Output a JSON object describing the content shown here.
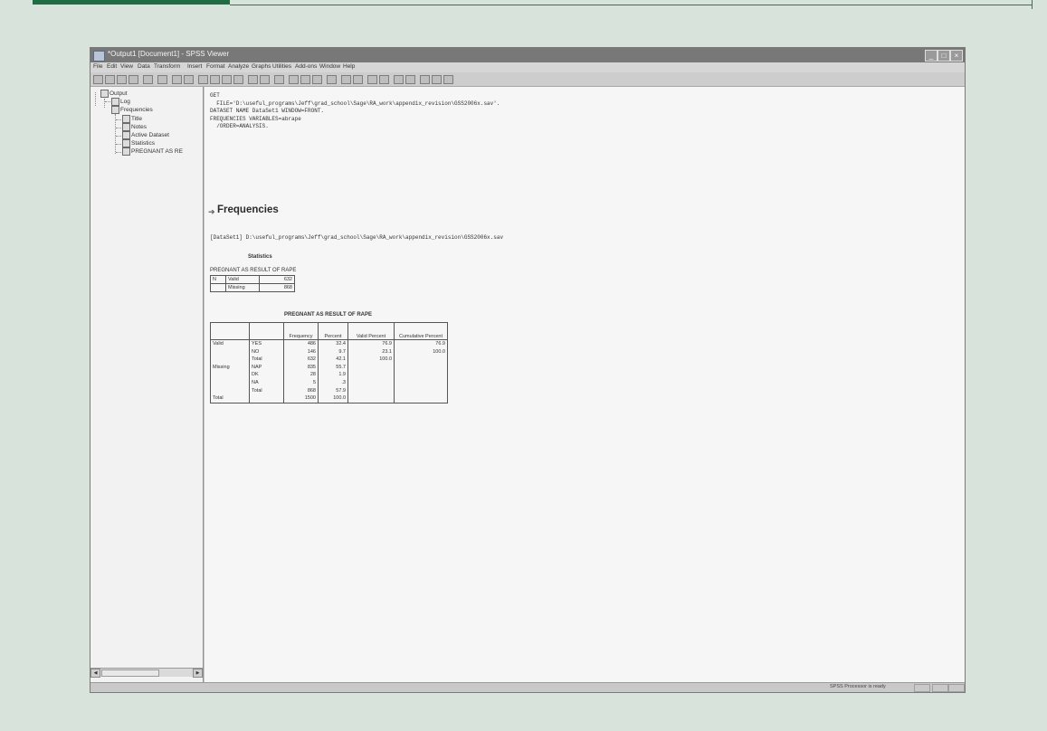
{
  "window": {
    "title": "*Output1 [Document1] - SPSS Viewer"
  },
  "window_buttons": [
    "_",
    "□",
    "×"
  ],
  "menu": [
    "File",
    "Edit",
    "View",
    "Data",
    "Transform",
    "Insert",
    "Format",
    "Analyze",
    "Graphs",
    "Utilities",
    "Add-ons",
    "Window",
    "Help"
  ],
  "outline": {
    "root": "Output",
    "items": [
      {
        "label": "Log",
        "icon": "log-icon"
      },
      {
        "label": "Frequencies",
        "icon": "book-icon"
      },
      {
        "label": "Title",
        "icon": "title-icon"
      },
      {
        "label": "Notes",
        "icon": "notes-icon"
      },
      {
        "label": "Active Dataset",
        "icon": "dataset-icon"
      },
      {
        "label": "Statistics",
        "icon": "table-icon"
      },
      {
        "label": "PREGNANT AS RE",
        "icon": "table-icon"
      }
    ]
  },
  "syntax_lines": [
    "GET",
    "  FILE='D:\\useful_programs\\Jeff\\grad_school\\Sage\\RA_work\\appendix_revision\\GSS2006x.sav'.",
    "DATASET NAME DataSet1 WINDOW=FRONT.",
    "FREQUENCIES VARIABLES=abrape",
    "  /ORDER=ANALYSIS."
  ],
  "heading": "Frequencies",
  "dataset_line": "[DataSet1] D:\\useful_programs\\Jeff\\grad_school\\Sage\\RA_work\\appendix_revision\\GSS2006x.sav",
  "statistics": {
    "title": "Statistics",
    "subtitle": "PREGNANT AS RESULT OF RAPE",
    "rows": [
      {
        "c1": "N",
        "c2": "Valid",
        "value": "632"
      },
      {
        "c1": "",
        "c2": "Missing",
        "value": "868"
      }
    ]
  },
  "frequency_table": {
    "title": "PREGNANT AS RESULT OF RAPE",
    "headers": [
      "",
      "",
      "Frequency",
      "Percent",
      "Valid Percent",
      "Cumulative Percent"
    ],
    "rows": [
      {
        "group": "Valid",
        "label": "YES",
        "freq": "486",
        "pct": "32.4",
        "valid": "76.9",
        "cum": "76.9"
      },
      {
        "group": "",
        "label": "NO",
        "freq": "146",
        "pct": "9.7",
        "valid": "23.1",
        "cum": "100.0"
      },
      {
        "group": "",
        "label": "Total",
        "freq": "632",
        "pct": "42.1",
        "valid": "100.0",
        "cum": ""
      },
      {
        "group": "Missing",
        "label": "NAP",
        "freq": "835",
        "pct": "55.7",
        "valid": "",
        "cum": ""
      },
      {
        "group": "",
        "label": "DK",
        "freq": "28",
        "pct": "1.9",
        "valid": "",
        "cum": ""
      },
      {
        "group": "",
        "label": "NA",
        "freq": "5",
        "pct": ".3",
        "valid": "",
        "cum": ""
      },
      {
        "group": "",
        "label": "Total",
        "freq": "868",
        "pct": "57.9",
        "valid": "",
        "cum": ""
      },
      {
        "group": "Total",
        "label": "",
        "freq": "1500",
        "pct": "100.0",
        "valid": "",
        "cum": ""
      }
    ]
  },
  "status": "SPSS  Processor is ready",
  "colors": {
    "background": "#d8e3dc",
    "accent": "#1f6e43",
    "titlebar": "#787878"
  }
}
